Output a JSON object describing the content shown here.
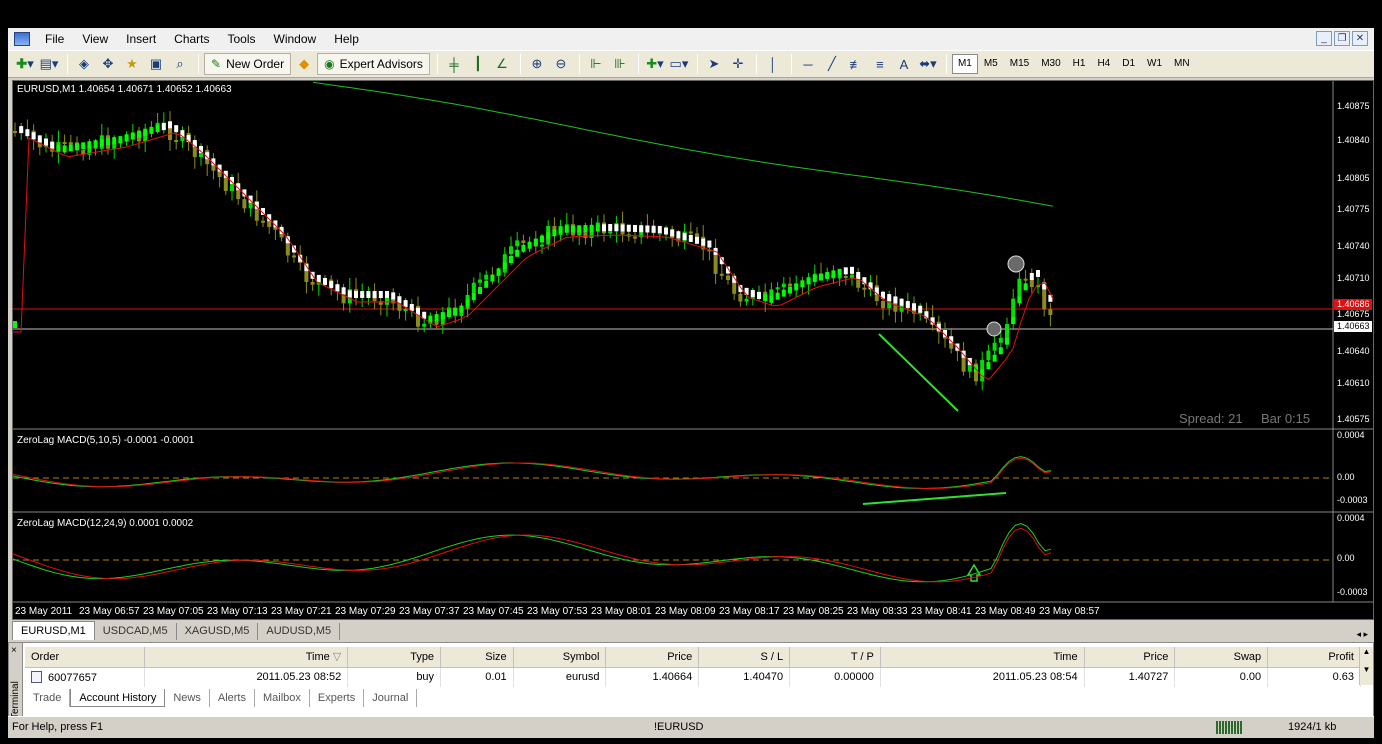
{
  "menu": [
    "File",
    "View",
    "Insert",
    "Charts",
    "Tools",
    "Window",
    "Help"
  ],
  "toolbar": {
    "new_order": "New Order",
    "expert_advisors": "Expert Advisors",
    "timeframes": [
      "M1",
      "M5",
      "M15",
      "M30",
      "H1",
      "H4",
      "D1",
      "W1",
      "MN"
    ],
    "active_timeframe": "M1",
    "text_tool": "A"
  },
  "chart": {
    "header": "EURUSD,M1  1.40654 1.40671 1.40652 1.40663",
    "spread_label": "Spread: 21",
    "bar_label": "Bar  0:15",
    "price_ticks": [
      "1.40875",
      "1.40840",
      "1.40805",
      "1.40775",
      "1.40740",
      "1.40710",
      "1.40686",
      "1.40675",
      "1.40663",
      "1.40640",
      "1.40610",
      "1.40575"
    ],
    "current_price_tag": "1.40663",
    "red_line_tag": "1.40686",
    "macd1_label": "ZeroLag MACD(5,10,5) -0.0001 -0.0001",
    "macd1_ticks": [
      "0.0004",
      "0.00",
      "-0.0003"
    ],
    "macd2_label": "ZeroLag MACD(12,24,9) 0.0001 0.0002",
    "macd2_ticks": [
      "0.0004",
      "0.00",
      "-0.0003"
    ],
    "time_ticks": [
      "23 May 2011",
      "23 May 06:57",
      "23 May 07:05",
      "23 May 07:13",
      "23 May 07:21",
      "23 May 07:29",
      "23 May 07:37",
      "23 May 07:45",
      "23 May 07:53",
      "23 May 08:01",
      "23 May 08:09",
      "23 May 08:17",
      "23 May 08:25",
      "23 May 08:33",
      "23 May 08:41",
      "23 May 08:49",
      "23 May 08:57"
    ],
    "colors": {
      "bull": "#00e000",
      "bear": "#8c8c1e",
      "ma_red": "#e01010",
      "ma_green": "#20c020",
      "background": "#000000"
    }
  },
  "chart_tabs": [
    "EURUSD,M1",
    "USDCAD,M5",
    "XAGUSD,M5",
    "AUDUSD,M5"
  ],
  "active_chart_tab": "EURUSD,M1",
  "terminal": {
    "label": "Terminal",
    "close_glyph": "×",
    "columns": [
      "Order",
      "Time",
      "Type",
      "Size",
      "Symbol",
      "Price",
      "S / L",
      "T / P",
      "Time",
      "Price",
      "Swap",
      "Profit"
    ],
    "rows": [
      {
        "order": "60077657",
        "time": "2011.05.23 08:52",
        "type": "buy",
        "size": "0.01",
        "symbol": "eurusd",
        "price": "1.40664",
        "sl": "1.40470",
        "tp": "0.00000",
        "close_time": "2011.05.23 08:54",
        "close_price": "1.40727",
        "swap": "0.00",
        "profit": "0.63"
      }
    ],
    "tabs": [
      "Trade",
      "Account History",
      "News",
      "Alerts",
      "Mailbox",
      "Experts",
      "Journal"
    ],
    "active_tab": "Account History"
  },
  "status": {
    "help": "For Help, press F1",
    "profile": "!EURUSD",
    "traffic": "1924/1 kb"
  }
}
